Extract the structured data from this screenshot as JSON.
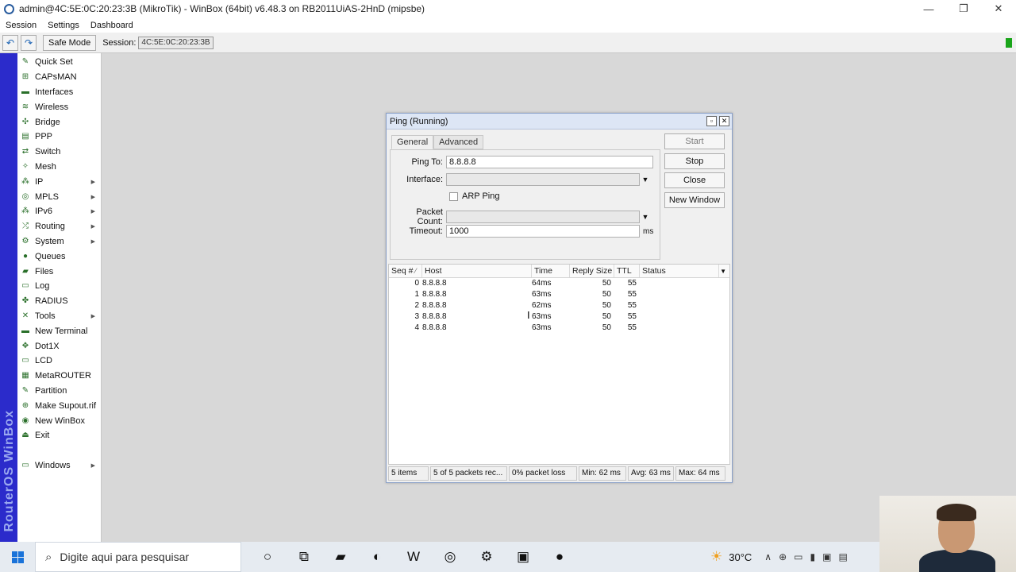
{
  "window": {
    "title": "admin@4C:5E:0C:20:23:3B (MikroTik) - WinBox (64bit) v6.48.3 on RB2011UiAS-2HnD (mipsbe)",
    "minimize_glyph": "—",
    "restore_glyph": "❐",
    "close_glyph": "✕"
  },
  "menu": [
    "Session",
    "Settings",
    "Dashboard"
  ],
  "toolbar": {
    "undo_glyph": "↶",
    "redo_glyph": "↷",
    "safe_mode_label": "Safe Mode",
    "session_label": "Session:",
    "session_value": "4C:5E:0C:20:23:3B"
  },
  "sidebar": {
    "brand": "RouterOS WinBox",
    "items": [
      {
        "label": "Quick Set",
        "icon": "✎",
        "arrow": ""
      },
      {
        "label": "CAPsMAN",
        "icon": "⊞",
        "arrow": ""
      },
      {
        "label": "Interfaces",
        "icon": "▬",
        "arrow": ""
      },
      {
        "label": "Wireless",
        "icon": "≋",
        "arrow": ""
      },
      {
        "label": "Bridge",
        "icon": "✣",
        "arrow": ""
      },
      {
        "label": "PPP",
        "icon": "▤",
        "arrow": ""
      },
      {
        "label": "Switch",
        "icon": "⇄",
        "arrow": ""
      },
      {
        "label": "Mesh",
        "icon": "✧",
        "arrow": ""
      },
      {
        "label": "IP",
        "icon": "⁂",
        "arrow": "▶"
      },
      {
        "label": "MPLS",
        "icon": "◎",
        "arrow": "▶"
      },
      {
        "label": "IPv6",
        "icon": "⁂",
        "arrow": "▶"
      },
      {
        "label": "Routing",
        "icon": "⤮",
        "arrow": "▶"
      },
      {
        "label": "System",
        "icon": "⚙",
        "arrow": "▶"
      },
      {
        "label": "Queues",
        "icon": "●",
        "arrow": ""
      },
      {
        "label": "Files",
        "icon": "▰",
        "arrow": ""
      },
      {
        "label": "Log",
        "icon": "▭",
        "arrow": ""
      },
      {
        "label": "RADIUS",
        "icon": "✤",
        "arrow": ""
      },
      {
        "label": "Tools",
        "icon": "✕",
        "arrow": "▶"
      },
      {
        "label": "New Terminal",
        "icon": "▬",
        "arrow": ""
      },
      {
        "label": "Dot1X",
        "icon": "✥",
        "arrow": ""
      },
      {
        "label": "LCD",
        "icon": "▭",
        "arrow": ""
      },
      {
        "label": "MetaROUTER",
        "icon": "▦",
        "arrow": ""
      },
      {
        "label": "Partition",
        "icon": "✎",
        "arrow": ""
      },
      {
        "label": "Make Supout.rif",
        "icon": "⊕",
        "arrow": ""
      },
      {
        "label": "New WinBox",
        "icon": "◉",
        "arrow": ""
      },
      {
        "label": "Exit",
        "icon": "⏏",
        "arrow": ""
      }
    ],
    "windows_item": {
      "label": "Windows",
      "icon": "▭",
      "arrow": "▶"
    }
  },
  "ping": {
    "title": "Ping (Running)",
    "tabs": [
      "General",
      "Advanced"
    ],
    "fields": {
      "ping_to_label": "Ping To:",
      "ping_to_value": "8.8.8.8",
      "interface_label": "Interface:",
      "interface_value": "",
      "arp_ping_label": "ARP Ping",
      "packet_count_label": "Packet Count:",
      "packet_count_value": "",
      "timeout_label": "Timeout:",
      "timeout_value": "1000",
      "timeout_unit": "ms"
    },
    "buttons": {
      "start": "Start",
      "stop": "Stop",
      "close": "Close",
      "new_window": "New Window"
    },
    "columns": [
      "Seq #",
      "Host",
      "Time",
      "Reply Size",
      "TTL",
      "Status"
    ],
    "rows": [
      {
        "seq": "0",
        "host": "8.8.8.8",
        "time": "64ms",
        "reply": "50",
        "ttl": "55",
        "status": ""
      },
      {
        "seq": "1",
        "host": "8.8.8.8",
        "time": "63ms",
        "reply": "50",
        "ttl": "55",
        "status": ""
      },
      {
        "seq": "2",
        "host": "8.8.8.8",
        "time": "62ms",
        "reply": "50",
        "ttl": "55",
        "status": ""
      },
      {
        "seq": "3",
        "host": "8.8.8.8",
        "time": "63ms",
        "reply": "50",
        "ttl": "55",
        "status": ""
      },
      {
        "seq": "4",
        "host": "8.8.8.8",
        "time": "63ms",
        "reply": "50",
        "ttl": "55",
        "status": ""
      }
    ],
    "status": {
      "items": "5 items",
      "received": "5 of 5 packets rec...",
      "loss": "0% packet loss",
      "min": "Min: 62 ms",
      "avg": "Avg: 63 ms",
      "max": "Max: 64 ms"
    }
  },
  "taskbar": {
    "search_placeholder": "Digite aqui para pesquisar",
    "apps": [
      {
        "name": "cortana-icon",
        "glyph": "○"
      },
      {
        "name": "task-view-icon",
        "glyph": "⧉"
      },
      {
        "name": "file-explorer-icon",
        "glyph": "▰"
      },
      {
        "name": "edge-icon",
        "glyph": "◐"
      },
      {
        "name": "word-icon",
        "glyph": "W"
      },
      {
        "name": "winbox-icon",
        "glyph": "◎"
      },
      {
        "name": "settings-icon",
        "glyph": "⚙"
      },
      {
        "name": "app-icon",
        "glyph": "▣"
      },
      {
        "name": "recorder-icon",
        "glyph": "●"
      }
    ],
    "weather_temp": "30°C",
    "tray_chevron": "∧"
  },
  "colors": {
    "sidebar_strip": "#2b2bcb",
    "status_led": "#1aa51a",
    "desktop": "#d8d8d8"
  }
}
